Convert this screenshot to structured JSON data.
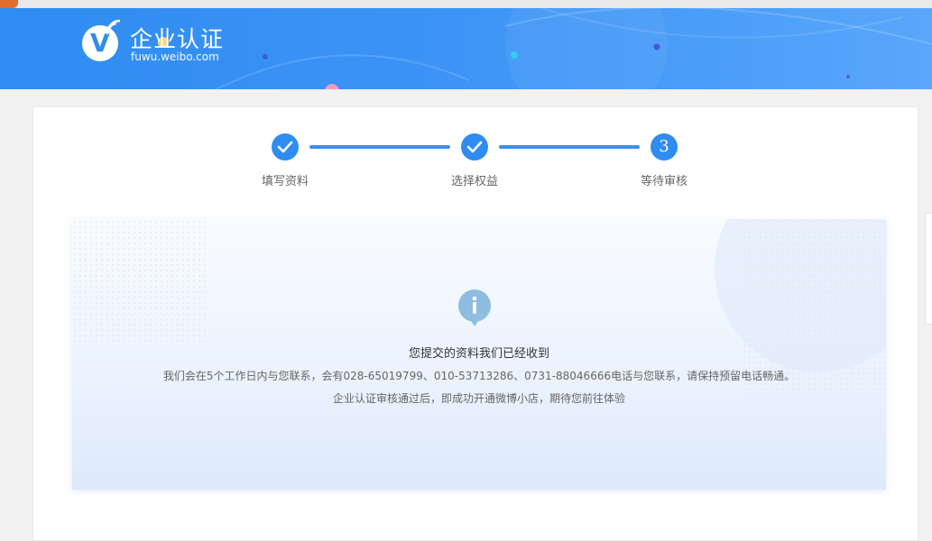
{
  "header": {
    "logo_letter": "V",
    "title": "企业认证",
    "domain": "fuwu.weibo.com"
  },
  "steps": [
    {
      "label": "填写资料",
      "state": "done"
    },
    {
      "label": "选择权益",
      "state": "done"
    },
    {
      "label": "等待审核",
      "state": "current",
      "number": "3"
    }
  ],
  "notice": {
    "title": "您提交的资料我们已经收到",
    "line1": "我们会在5个工作日内与您联系，会有028-65019799、010-53713286、0731-88046666电话与您联系，请保持预留电话畅通。",
    "line2": "企业认证审核通过后，即成功开通微博小店，期待您前往体验"
  },
  "colors": {
    "brand_blue": "#2f8cf1",
    "info_icon": "#8dbde0"
  }
}
